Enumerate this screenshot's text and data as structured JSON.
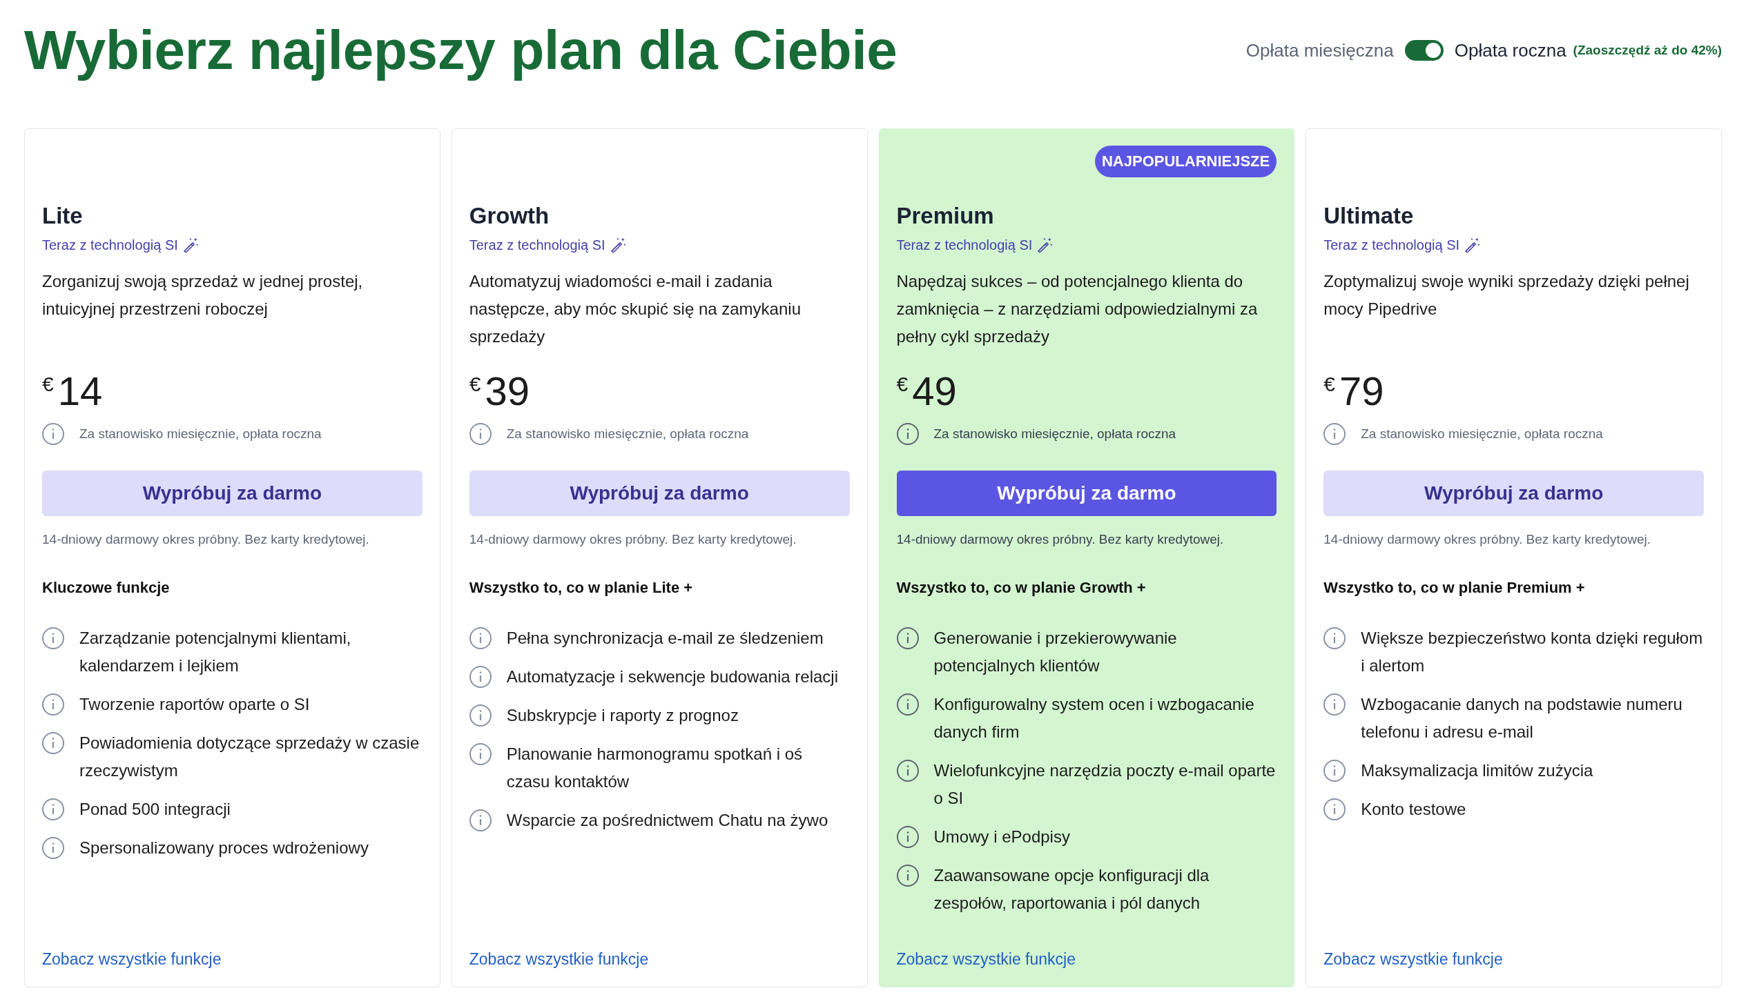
{
  "title": "Wybierz najlepszy plan dla Ciebie",
  "billing_toggle": {
    "monthly_label": "Opłata miesięczna",
    "on": true,
    "annual_label": "Opłata roczna",
    "savings_note": "(Zaoszczędź aż do 42%)"
  },
  "plans": [
    {
      "highlighted": false,
      "name": "Lite",
      "ai_note": "Teraz z technologią SI",
      "description": "Zorganizuj swoją sprzedaż w jednej prostej, intuicyjnej przestrzeni roboczej",
      "currency": "€",
      "price": "14",
      "price_note": "Za stanowisko miesięcznie, opłata roczna",
      "cta": "Wypróbuj za darmo",
      "trial_note": "14-dniowy darmowy okres próbny. Bez karty kredytowej.",
      "features_heading": "Kluczowe funkcje",
      "features": [
        "Zarządzanie potencjalnymi klientami, kalendarzem i lejkiem",
        "Tworzenie raportów oparte o SI",
        "Powiadomienia dotyczące sprzedaży w czasie rzeczywistym",
        "Ponad 500 integracji",
        "Spersonalizowany proces wdrożeniowy"
      ],
      "link": "Zobacz wszystkie funkcje"
    },
    {
      "highlighted": false,
      "name": "Growth",
      "ai_note": "Teraz z technologią SI",
      "description": "Automatyzuj wiadomości e-mail i zadania następcze, aby móc skupić się na zamykaniu sprzedaży",
      "currency": "€",
      "price": "39",
      "price_note": "Za stanowisko miesięcznie, opłata roczna",
      "cta": "Wypróbuj za darmo",
      "trial_note": "14-dniowy darmowy okres próbny. Bez karty kredytowej.",
      "features_heading": "Wszystko to, co w planie Lite +",
      "features": [
        "Pełna synchronizacja e-mail ze śledzeniem",
        "Automatyzacje i sekwencje budowania relacji",
        "Subskrypcje i raporty z prognoz",
        "Planowanie harmonogramu spotkań i oś czasu kontaktów",
        "Wsparcie za pośrednictwem Chatu na żywo"
      ],
      "link": "Zobacz wszystkie funkcje"
    },
    {
      "highlighted": true,
      "badge": "NAJPOPULARNIEJSZE",
      "name": "Premium",
      "ai_note": "Teraz z technologią SI",
      "description": "Napędzaj sukces – od potencjalnego klienta do zamknięcia – z narzędziami odpowiedzialnymi za pełny cykl sprzedaży",
      "currency": "€",
      "price": "49",
      "price_note": "Za stanowisko miesięcznie, opłata roczna",
      "cta": "Wypróbuj za darmo",
      "trial_note": "14-dniowy darmowy okres próbny. Bez karty kredytowej.",
      "features_heading": "Wszystko to, co w planie Growth +",
      "features": [
        "Generowanie i przekierowywanie potencjalnych klientów",
        "Konfigurowalny system ocen i wzbogacanie danych firm",
        "Wielofunkcyjne narzędzia poczty e-mail oparte o SI",
        "Umowy i ePodpisy",
        "Zaawansowane opcje konfiguracji dla zespołów, raportowania i pól danych"
      ],
      "link": "Zobacz wszystkie funkcje"
    },
    {
      "highlighted": false,
      "name": "Ultimate",
      "ai_note": "Teraz z technologią SI",
      "description": "Zoptymalizuj swoje wyniki sprzedaży dzięki pełnej mocy Pipedrive",
      "currency": "€",
      "price": "79",
      "price_note": "Za stanowisko miesięcznie, opłata roczna",
      "cta": "Wypróbuj za darmo",
      "trial_note": "14-dniowy darmowy okres próbny. Bez karty kredytowej.",
      "features_heading": "Wszystko to, co w planie Premium +",
      "features": [
        "Większe bezpieczeństwo konta dzięki regułom i alertom",
        "Wzbogacanie danych na podstawie numeru telefonu i adresu e-mail",
        "Maksymalizacja limitów zużycia",
        "Konto testowe"
      ],
      "link": "Zobacz wszystkie funkcje"
    }
  ]
}
